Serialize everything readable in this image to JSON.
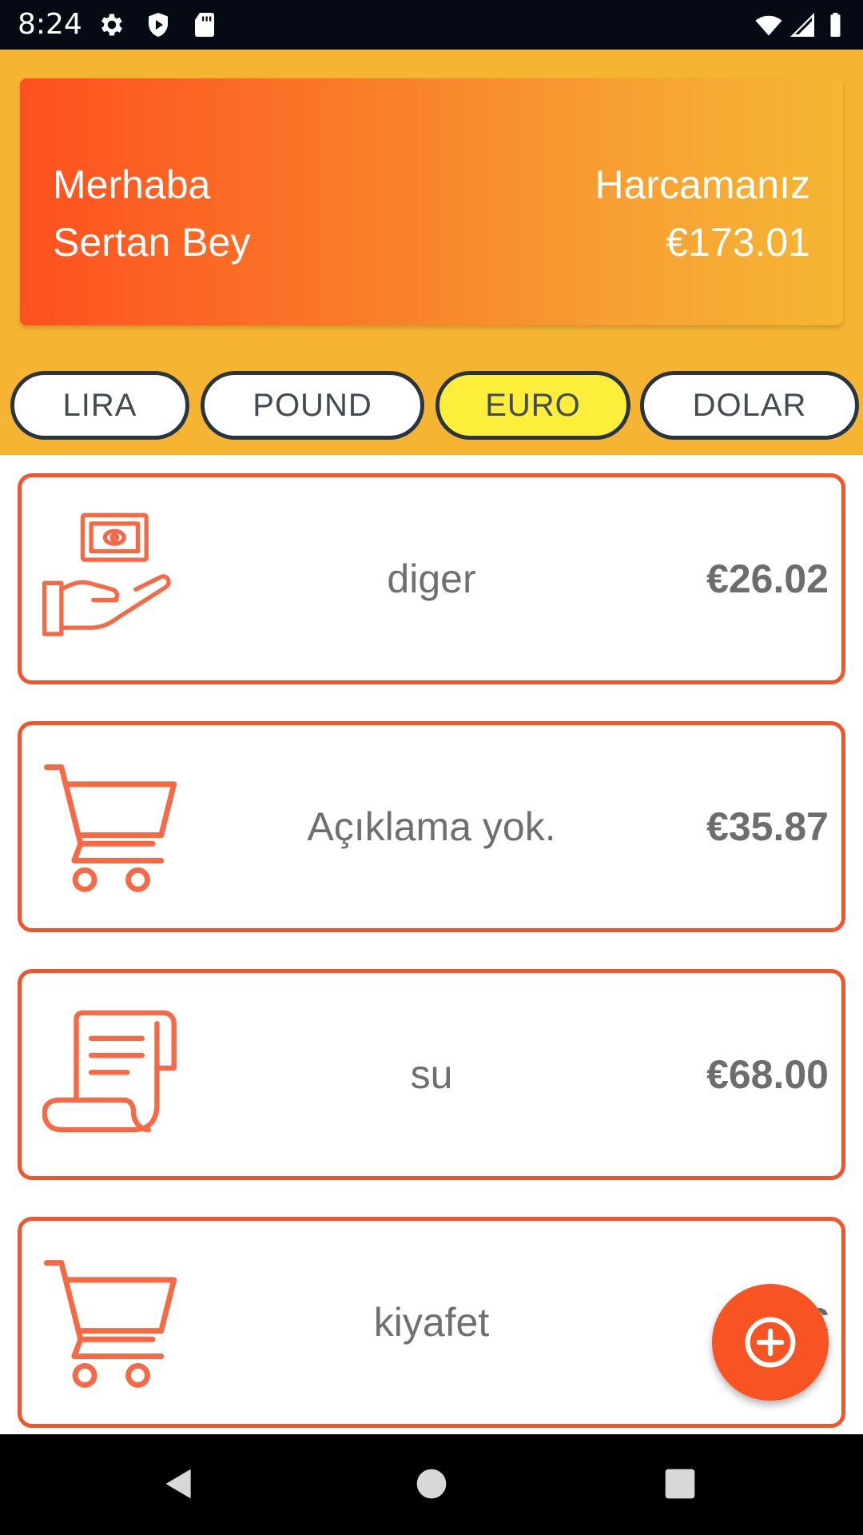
{
  "status_bar": {
    "time": "8:24",
    "left_icons": [
      "gear-icon",
      "shield-play-icon",
      "sd-card-icon"
    ],
    "right_icons": [
      "wifi-icon",
      "cell-signal-icon",
      "battery-icon"
    ]
  },
  "header": {
    "greeting_line1": "Merhaba",
    "greeting_line2": "Sertan Bey",
    "spend_label": "Harcamanız",
    "spend_total": "€173.01",
    "gradient_colors": [
      "#ff5020",
      "#f5b633"
    ],
    "background": "#f5b533"
  },
  "currencies": [
    {
      "label": "LIRA",
      "active": false
    },
    {
      "label": "POUND",
      "active": false
    },
    {
      "label": "EURO",
      "active": true
    },
    {
      "label": "DOLAR",
      "active": false
    }
  ],
  "expenses": [
    {
      "icon": "hand-money-icon",
      "description": "diger",
      "amount": "€26.02"
    },
    {
      "icon": "shopping-cart-icon",
      "description": "Açıklama yok.",
      "amount": "€35.87"
    },
    {
      "icon": "receipt-scroll-icon",
      "description": "su",
      "amount": "€68.00"
    },
    {
      "icon": "shopping-cart-icon",
      "description": "kiyafet",
      "amount": "€"
    }
  ],
  "fab": {
    "icon": "add-circle-icon"
  },
  "nav_bar": {
    "icons": [
      "back-icon",
      "home-icon",
      "recents-icon"
    ]
  },
  "colors": {
    "accent": "#f2552b",
    "active_chip": "#fcee3b",
    "chip_border": "#283540"
  }
}
